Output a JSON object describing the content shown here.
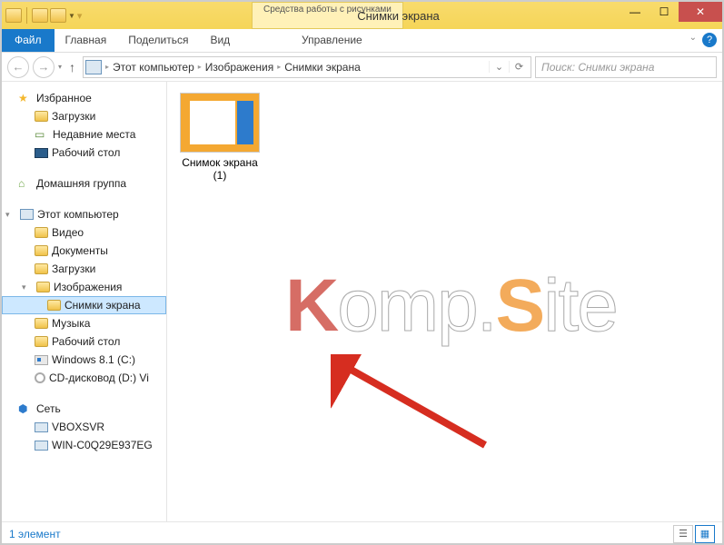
{
  "window": {
    "title": "Снимки экрана",
    "contextual_tab_header": "Средства работы с рисунками"
  },
  "ribbon": {
    "file": "Файл",
    "tabs": [
      "Главная",
      "Поделиться",
      "Вид"
    ],
    "contextual": "Управление"
  },
  "breadcrumbs": [
    "Этот компьютер",
    "Изображения",
    "Снимки экрана"
  ],
  "search": {
    "placeholder": "Поиск: Снимки экрана"
  },
  "sidebar": {
    "favorites": {
      "label": "Избранное",
      "items": [
        "Загрузки",
        "Недавние места",
        "Рабочий стол"
      ]
    },
    "homegroup": "Домашняя группа",
    "computer": {
      "label": "Этот компьютер",
      "items": [
        "Видео",
        "Документы",
        "Загрузки",
        "Изображения"
      ],
      "subfolder": "Снимки экрана",
      "items2": [
        "Музыка",
        "Рабочий стол",
        "Windows 8.1 (C:)",
        "CD-дисковод (D:) Vi"
      ]
    },
    "network": {
      "label": "Сеть",
      "items": [
        "VBOXSVR",
        "WIN-C0Q29E937EG"
      ]
    }
  },
  "content": {
    "files": [
      {
        "name": "Снимок экрана (1)"
      }
    ]
  },
  "status": {
    "text": "1 элемент"
  },
  "watermark": {
    "part1": "K",
    "part2": "omp.",
    "part3": "S",
    "part4": "ite"
  }
}
